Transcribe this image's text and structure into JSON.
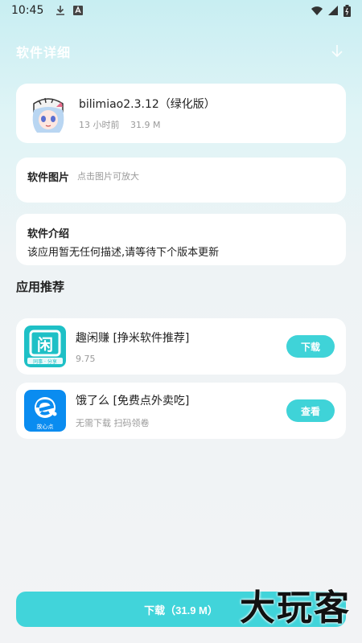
{
  "status_bar": {
    "time": "10:45"
  },
  "header": {
    "title": "软件详细"
  },
  "app": {
    "name": "bilimiao2.3.12（绿化版）",
    "updated": "13 小时前",
    "size": "31.9 M"
  },
  "screenshots": {
    "label": "软件图片",
    "hint": "点击图片可放大"
  },
  "intro": {
    "label": "软件介绍",
    "text": "该应用暂无任何描述,请等待下个版本更新"
  },
  "recommend": {
    "title": "应用推荐",
    "items": [
      {
        "name": "趣闲赚 [挣米软件推荐]",
        "sub": "9.75",
        "button": "下载",
        "icon_text": "闲",
        "icon_caption": "同事 · 分享"
      },
      {
        "name": "饿了么 [免费点外卖吃]",
        "sub": "无需下载 扫码领卷",
        "button": "查看",
        "icon_caption": "放心点"
      }
    ]
  },
  "download_button": "下载（31.9 M）",
  "watermark": "大玩客",
  "colors": {
    "accent": "#41d4da",
    "background_top": "#c8eef2"
  }
}
